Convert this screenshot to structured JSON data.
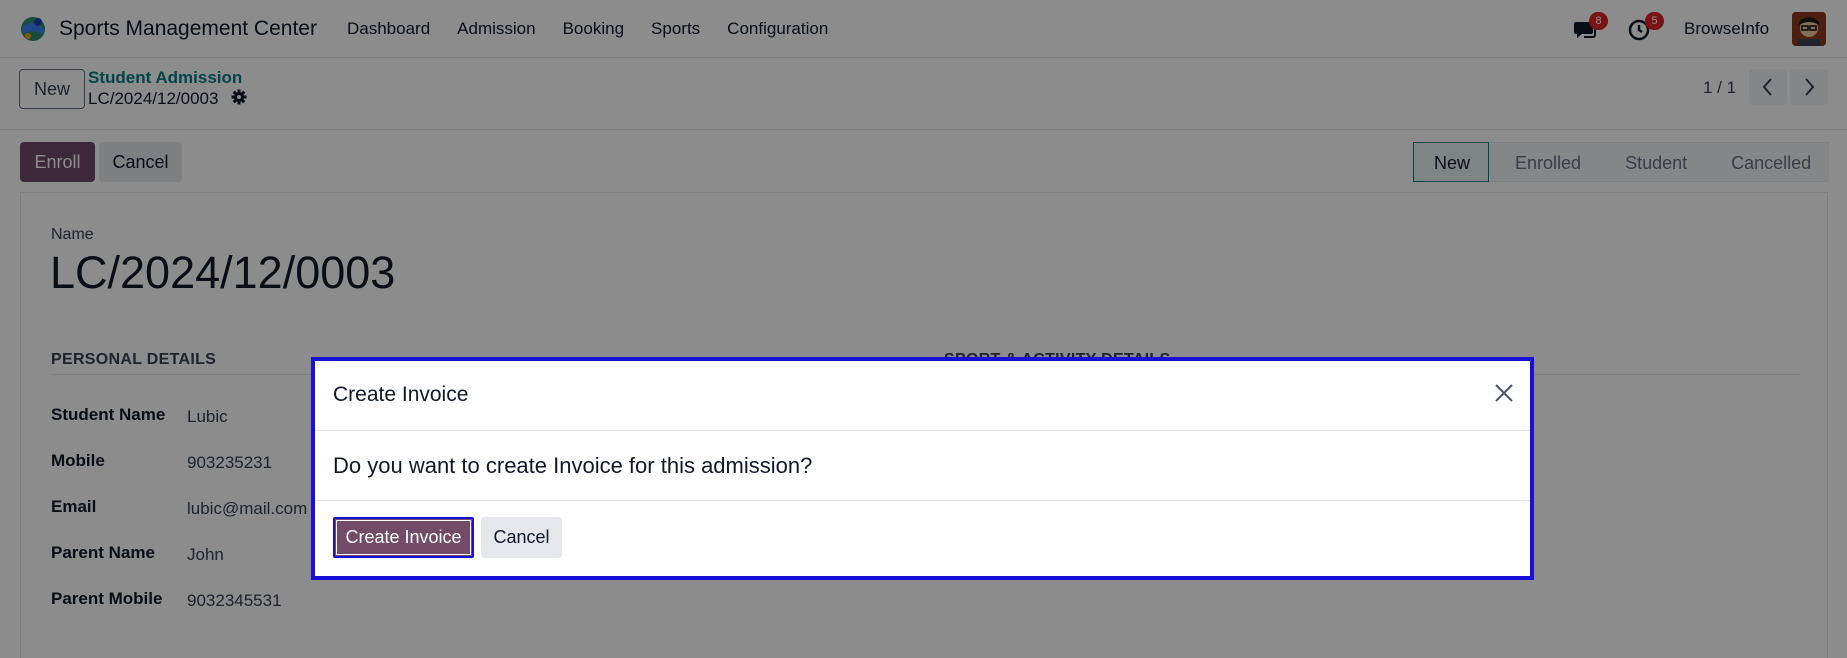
{
  "navbar": {
    "app_name": "Sports Management Center",
    "menu": [
      "Dashboard",
      "Admission",
      "Booking",
      "Sports",
      "Configuration"
    ],
    "messages_badge": "8",
    "activities_badge": "5",
    "user_name": "BrowseInfo"
  },
  "control_panel": {
    "new_label": "New",
    "breadcrumb_parent": "Student Admission",
    "breadcrumb_current": "LC/2024/12/0003",
    "pager": "1 / 1"
  },
  "statusbar": {
    "enroll_label": "Enroll",
    "cancel_label": "Cancel",
    "stages": [
      "New",
      "Enrolled",
      "Student",
      "Cancelled"
    ],
    "active_stage": "New"
  },
  "form": {
    "name_label": "Name",
    "name_value": "LC/2024/12/0003",
    "personal_section": "PERSONAL DETAILS",
    "sport_section": "SPORT & ACTIVITY DETAILS",
    "fields": [
      {
        "label": "Student Name",
        "value": "Lubic"
      },
      {
        "label": "Mobile",
        "value": "903235231"
      },
      {
        "label": "Email",
        "value": "lubic@mail.com"
      },
      {
        "label": "Parent Name",
        "value": "John"
      },
      {
        "label": "Parent Mobile",
        "value": "9032345531"
      }
    ]
  },
  "dialog": {
    "title": "Create Invoice",
    "message": "Do you want to create Invoice for this admission?",
    "confirm_label": "Create Invoice",
    "cancel_label": "Cancel"
  },
  "colors": {
    "primary": "#714b67",
    "link": "#017e84",
    "highlight_border": "#1a0fd6",
    "badge": "#dc2626"
  }
}
